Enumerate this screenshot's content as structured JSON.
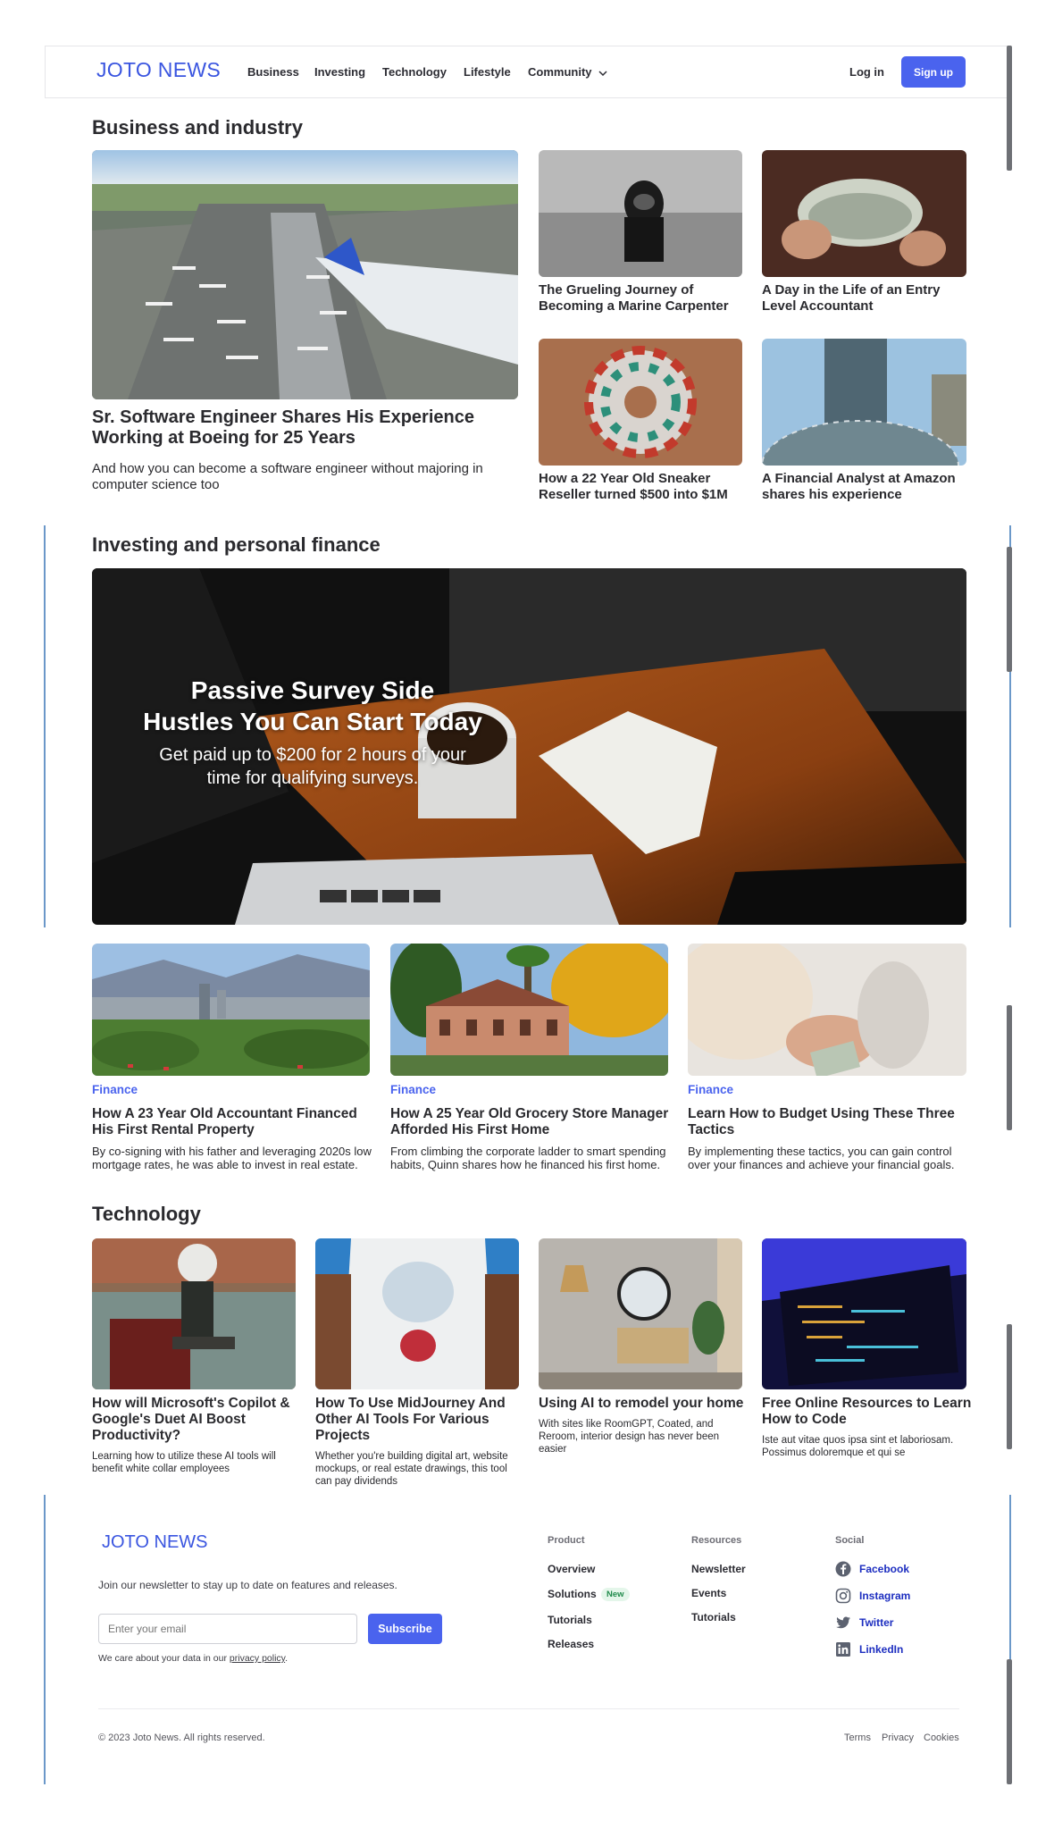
{
  "header": {
    "logo": "JOTO NEWS",
    "nav": [
      "Business",
      "Investing",
      "Technology",
      "Lifestyle",
      "Community"
    ],
    "login": "Log in",
    "signup": "Sign up"
  },
  "business": {
    "title": "Business and industry",
    "feature": {
      "title": "Sr. Software Engineer Shares His Experience Working at Boeing for 25 Years",
      "desc": "And how you can become a software engineer without majoring in computer science too"
    },
    "cards": [
      {
        "title": "The Grueling Journey of Becoming a Marine Carpenter"
      },
      {
        "title": "A Day in the Life of an Entry Level Accountant"
      },
      {
        "title": "How a 22 Year Old Sneaker Reseller turned $500 into $1M"
      },
      {
        "title": "A Financial Analyst at Amazon shares his experience"
      }
    ]
  },
  "investing": {
    "title": "Investing and personal finance",
    "hero": {
      "title": "Passive Survey Side Hustles You Can Start Today",
      "subtitle": "Get paid up to $200 for 2 hours of your time for qualifying surveys."
    },
    "cards": [
      {
        "category": "Finance",
        "title": "How A 23 Year Old Accountant Financed His First Rental Property",
        "desc": "By co-signing with his father and leveraging 2020s low mortgage rates, he was able to invest in real estate."
      },
      {
        "category": "Finance",
        "title": "How A 25 Year Old Grocery Store Manager Afforded His First Home",
        "desc": "From climbing the corporate ladder to smart spending habits, Quinn shares how he financed his first home."
      },
      {
        "category": "Finance",
        "title": "Learn How to Budget Using These Three Tactics",
        "desc": "By implementing these tactics, you can gain control over your finances and achieve your financial goals."
      }
    ]
  },
  "technology": {
    "title": "Technology",
    "cards": [
      {
        "title": "How will Microsoft's Copilot & Google's Duet AI Boost Productivity?",
        "desc": "Learning how to utilize these AI tools will benefit white collar employees"
      },
      {
        "title": "How To Use MidJourney And Other AI Tools For Various Projects",
        "desc": "Whether you're building digital art, website mockups, or real estate drawings, this tool can pay dividends"
      },
      {
        "title": "Using AI to remodel your home",
        "desc": "With sites like RoomGPT, Coated, and Reroom, interior design has never been easier"
      },
      {
        "title": "Free Online Resources to Learn How to Code",
        "desc": "Iste aut vitae quos ipsa sint et laboriosam. Possimus doloremque et qui se"
      }
    ]
  },
  "footer": {
    "logo": "JOTO NEWS",
    "newsletter_text": "Join our newsletter to stay up to date on features and releases.",
    "email_placeholder": "Enter your email",
    "subscribe": "Subscribe",
    "privacy_prefix": "We care about your data in our ",
    "privacy_link": "privacy policy",
    "privacy_suffix": ".",
    "product": {
      "heading": "Product",
      "links": [
        "Overview",
        "Solutions",
        "Tutorials",
        "Releases"
      ],
      "badge": "New"
    },
    "resources": {
      "heading": "Resources",
      "links": [
        "Newsletter",
        "Events",
        "Tutorials"
      ]
    },
    "social": {
      "heading": "Social",
      "links": [
        {
          "label": "Facebook",
          "icon": "facebook-icon"
        },
        {
          "label": "Instagram",
          "icon": "instagram-icon"
        },
        {
          "label": "Twitter",
          "icon": "twitter-icon"
        },
        {
          "label": "LinkedIn",
          "icon": "linkedin-icon"
        }
      ]
    },
    "copyright": "© 2023 Joto News. All rights reserved.",
    "bottom_links": [
      "Terms",
      "Privacy",
      "Cookies"
    ]
  },
  "colors": {
    "accent": "#4a63ee",
    "logo": "#3a55e0",
    "text": "#2a2a2e",
    "frame_line": "#6b98c9"
  }
}
